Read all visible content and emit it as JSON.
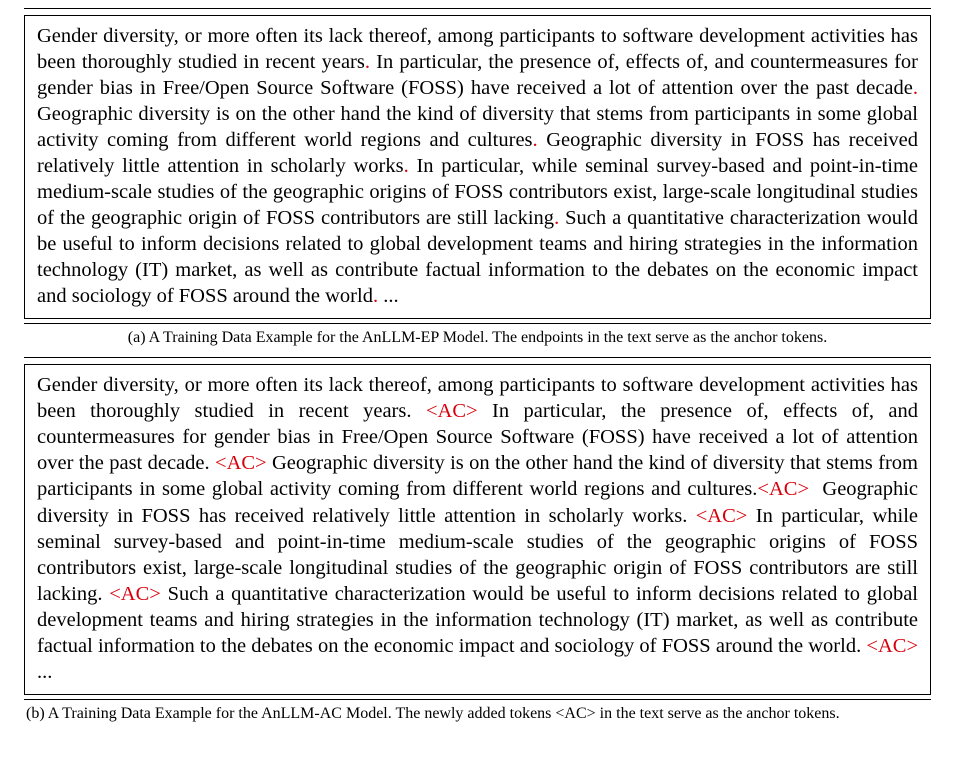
{
  "figureA": {
    "sentences": [
      "Gender diversity, or more often its lack thereof, among participants to software development activities has been thoroughly studied in recent years",
      "In particular, the presence of, effects of, and countermeasures for gender bias in Free/Open Source Software (FOSS) have received a lot of attention over the past decade",
      "Geographic diversity is on the other hand the kind of diversity that stems from participants in some global activity coming from different world regions and cultures",
      "Geographic diversity in FOSS has received relatively little attention in scholarly works",
      "In particular, while seminal survey-based and point-in-time medium-scale studies of the geographic origins of FOSS contributors exist, large-scale longitudinal studies of the geographic origin of FOSS contributors are still lacking",
      "Such a quantitative characterization would be useful to inform decisions related to global development teams and hiring strategies in the information technology (IT) market, as well as contribute factual information to the debates on the economic impact and sociology of FOSS around the world"
    ],
    "period": ".",
    "ellipsis": "...",
    "caption": "(a) A Training Data Example for the AnLLM-EP Model. The endpoints in the text serve as the anchor tokens."
  },
  "figureB": {
    "sentences": [
      "Gender diversity, or more often its lack thereof, among participants to software development activities has been thoroughly studied in recent years.",
      "In particular, the presence of, effects of, and countermeasures for gender bias in Free/Open Source Software (FOSS) have received a lot of attention over the past decade.",
      "Geographic diversity is on the other hand the kind of diversity that stems from participants in some global activity coming from different world regions and cultures.",
      "Geographic diversity in FOSS has received relatively little attention in scholarly works.",
      "In particular, while seminal survey-based and point-in-time medium-scale studies of the geographic origins of FOSS contributors exist, large-scale longitudinal studies of the geographic origin of FOSS contributors are still lacking.",
      "Such a quantitative characterization would be useful to inform decisions related to global development teams and hiring strategies in the information technology (IT) market, as well as contribute factual information to the debates on the economic impact and sociology of FOSS around the world."
    ],
    "ac_token": "<AC>",
    "ellipsis": "...",
    "caption": "(b) A Training Data Example for the AnLLM-AC Model. The newly added tokens <AC> in the text serve as the anchor tokens."
  }
}
